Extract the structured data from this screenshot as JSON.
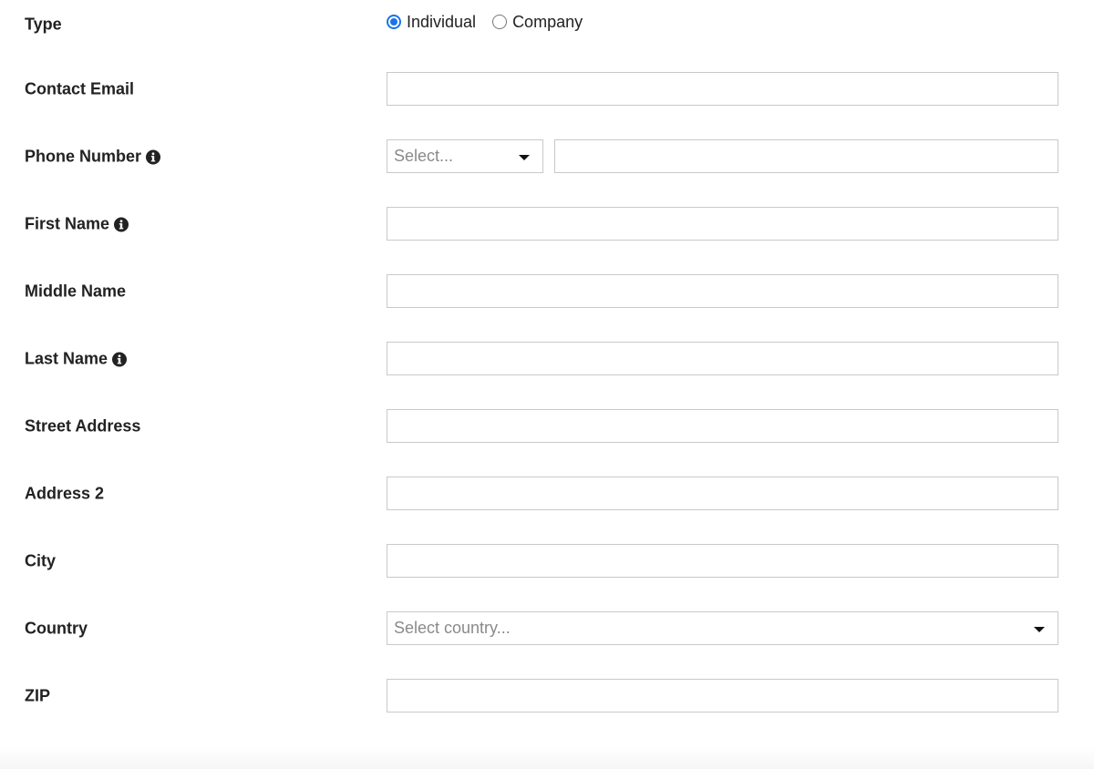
{
  "type_field": {
    "label": "Type",
    "options": [
      {
        "label": "Individual",
        "checked": true
      },
      {
        "label": "Company",
        "checked": false
      }
    ]
  },
  "contact_email": {
    "label": "Contact Email",
    "value": ""
  },
  "phone_number": {
    "label": "Phone Number",
    "code_placeholder": "Select...",
    "value": ""
  },
  "first_name": {
    "label": "First Name",
    "value": ""
  },
  "middle_name": {
    "label": "Middle Name",
    "value": ""
  },
  "last_name": {
    "label": "Last Name",
    "value": ""
  },
  "street_address": {
    "label": "Street Address",
    "value": ""
  },
  "address_2": {
    "label": "Address 2",
    "value": ""
  },
  "city": {
    "label": "City",
    "value": ""
  },
  "country": {
    "label": "Country",
    "placeholder": "Select country..."
  },
  "zip": {
    "label": "ZIP",
    "value": ""
  },
  "icons": {
    "info": "info-circle-icon"
  },
  "colors": {
    "accent": "#1a73e8",
    "border": "#c9c9c9",
    "label": "#222222",
    "placeholder": "#8a8a8a"
  }
}
